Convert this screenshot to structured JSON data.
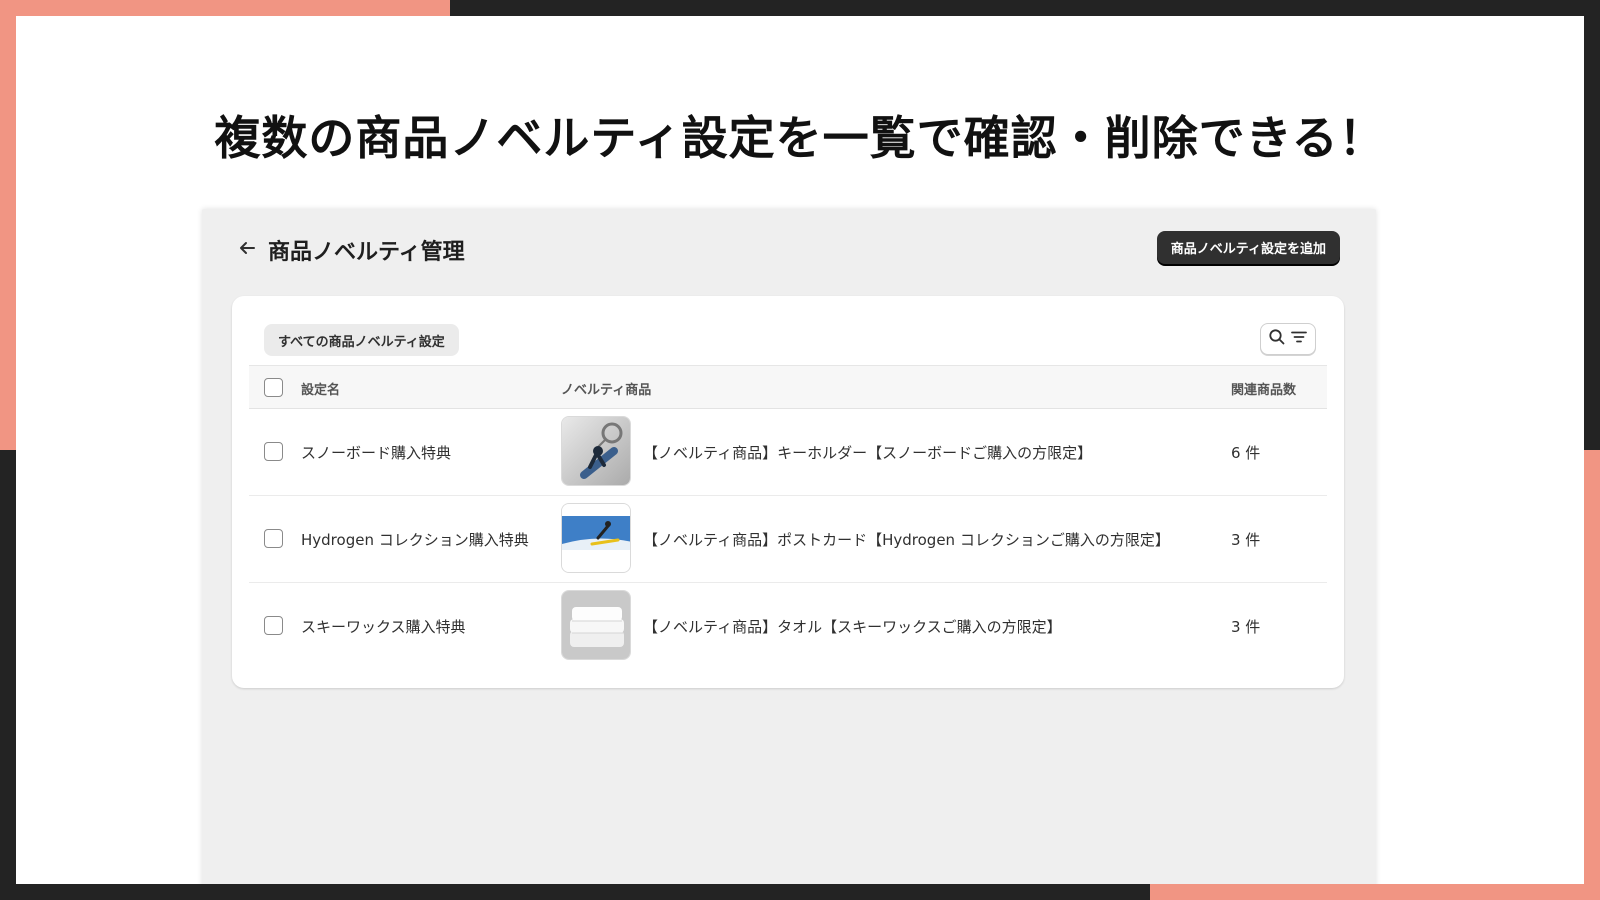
{
  "headline": "複数の商品ノベルティ設定を一覧で確認・削除できる！",
  "app": {
    "title": "商品ノベルティ管理",
    "add_button": "商品ノベルティ設定を追加",
    "view_tab": "すべての商品ノベルティ設定"
  },
  "table": {
    "headers": {
      "name": "設定名",
      "product": "ノベルティ商品",
      "count": "関連商品数"
    },
    "rows": [
      {
        "name": "スノーボード購入特典",
        "product": "【ノベルティ商品】キーホルダー【スノーボードご購入の方限定】",
        "count": "6 件",
        "thumb": "keychain-image"
      },
      {
        "name": "Hydrogen コレクション購入特典",
        "product": "【ノベルティ商品】ポストカード【Hydrogen コレクションご購入の方限定】",
        "count": "3 件",
        "thumb": "postcard-image"
      },
      {
        "name": "スキーワックス購入特典",
        "product": "【ノベルティ商品】タオル【スキーワックスご購入の方限定】",
        "count": "3 件",
        "thumb": "towel-image"
      }
    ]
  },
  "icons": {
    "back": "arrow-left-icon",
    "search": "search-icon",
    "filter": "filter-icon"
  },
  "colors": {
    "accent_coral": "#f19583",
    "dark_frame": "#232323",
    "primary_button": "#303030",
    "app_background": "#efefef"
  }
}
